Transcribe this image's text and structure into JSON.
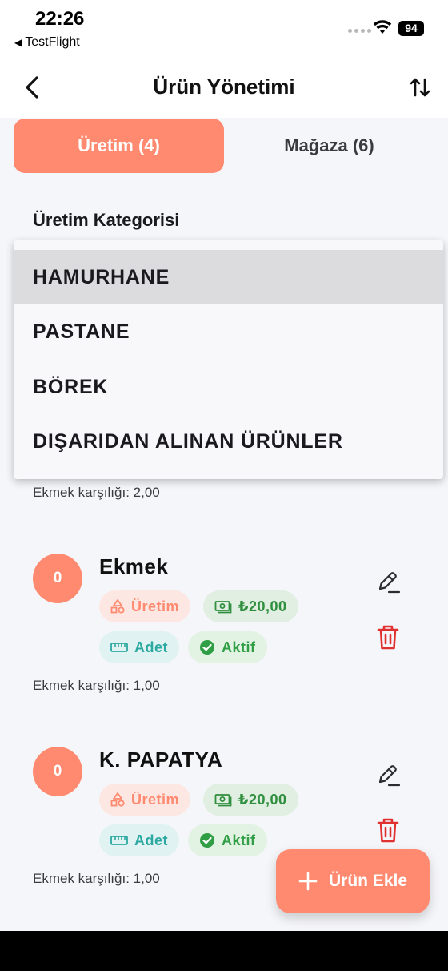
{
  "status_bar": {
    "time": "22:26",
    "back_app": "TestFlight",
    "battery": "94"
  },
  "nav": {
    "title": "Ürün Yönetimi",
    "back_icon": "chevron-left-icon",
    "sort_icon": "sort-arrows-icon"
  },
  "tabs": [
    {
      "label": "Üretim (4)",
      "active": true
    },
    {
      "label": "Mağaza (6)",
      "active": false
    }
  ],
  "category": {
    "label": "Üretim Kategorisi",
    "options": [
      "HAMURHANE",
      "PASTANE",
      "BÖREK",
      "DIŞARIDAN ALINAN ÜRÜNLER"
    ],
    "selected": "HAMURHANE"
  },
  "products": [
    {
      "partial_note": "Ekmek karşılığı: 2,00"
    },
    {
      "avatar": "0",
      "name": "Ekmek",
      "chips": {
        "type": "Üretim",
        "price": "₺20,00",
        "unit": "Adet",
        "status": "Aktif"
      },
      "note": "Ekmek karşılığı: 1,00"
    },
    {
      "avatar": "0",
      "name": "K. PAPATYA",
      "chips": {
        "type": "Üretim",
        "price": "₺20,00",
        "unit": "Adet",
        "status": "Aktif"
      },
      "note": "Ekmek karşılığı: 1,00"
    }
  ],
  "fab": {
    "label": "Ürün Ekle",
    "icon": "plus-icon"
  },
  "colors": {
    "accent": "#ff8a70",
    "delete": "#e03131",
    "success": "#2f9e44",
    "teal": "#2ba9a0"
  }
}
